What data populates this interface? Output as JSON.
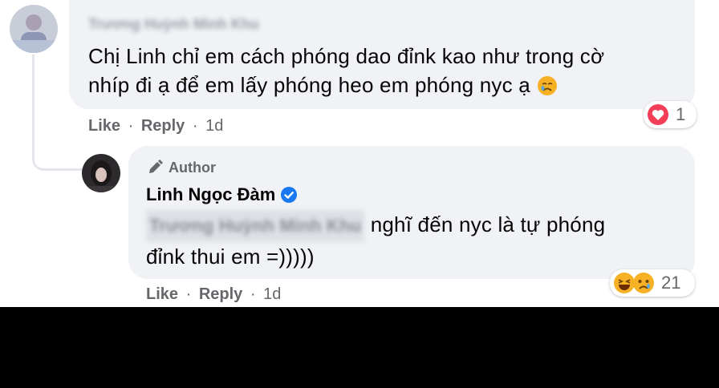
{
  "comment1": {
    "author_name": "Trương Huỳnh Minh Khu",
    "text_line1": "Chị Linh chỉ em cách phóng dao đỉnk kao như trong cờ",
    "text_line2": "nhíp đi ạ để em lấy phóng heo em phóng nyc ạ",
    "like_label": "Like",
    "reply_label": "Reply",
    "time": "1d",
    "reaction_count": "1",
    "reaction_icon": "love-icon",
    "emoji_icon": "crying-face-icon"
  },
  "reply1": {
    "badge_label": "Author",
    "author_name": "Linh Ngọc Đàm",
    "verified_icon": "verified-badge-icon",
    "mention": "Trương Huỳnh Minh Khu",
    "text_line1": "nghĩ đến nyc là tự phóng",
    "text_line2": "đỉnk thui em =)))))",
    "like_label": "Like",
    "reply_label": "Reply",
    "time": "1d",
    "reaction_count": "21",
    "reaction_icons": [
      "haha-icon",
      "sad-icon"
    ]
  },
  "colors": {
    "bubble": "#f0f2f5",
    "text": "#050505",
    "secondary": "#65676b",
    "love": "#f33e58",
    "verified": "#1877f2",
    "reaction_yellow": "#f7b125"
  }
}
